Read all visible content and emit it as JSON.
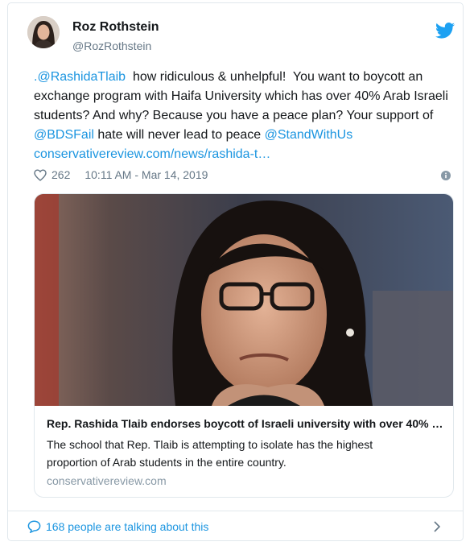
{
  "author": {
    "name": "Roz Rothstein",
    "handle": "@RozRothstein"
  },
  "tweet": {
    "mention1": ".@RashidaTlaib",
    "part1": "  how ridiculous & unhelpful!  You want to boycott an exchange program with Haifa University which has over 40% Arab Israeli students? And why? Because you have a peace plan? Your support of ",
    "mention2": "@BDSFail",
    "part2": " hate will never lead to peace ",
    "mention3": "@StandWithUs",
    "link": "conservativereview.com/news/rashida-t…"
  },
  "meta": {
    "likes": "262",
    "timestamp": "10:11 AM - Mar 14, 2019"
  },
  "link_card": {
    "title": "Rep. Rashida Tlaib endorses boycott of Israeli university with over 40% …",
    "description": "The school that Rep. Tlaib is attempting to isolate has the highest proportion of Arab students in the entire country.",
    "domain": "conservativereview.com"
  },
  "footer": {
    "talking": "168 people are talking about this"
  },
  "colors": {
    "link": "#1b95e0",
    "muted": "#657786",
    "border": "#e1e8ed"
  },
  "icons": [
    "twitter-bird-icon",
    "heart-icon",
    "info-icon",
    "speech-bubble-icon",
    "chevron-right-icon"
  ]
}
